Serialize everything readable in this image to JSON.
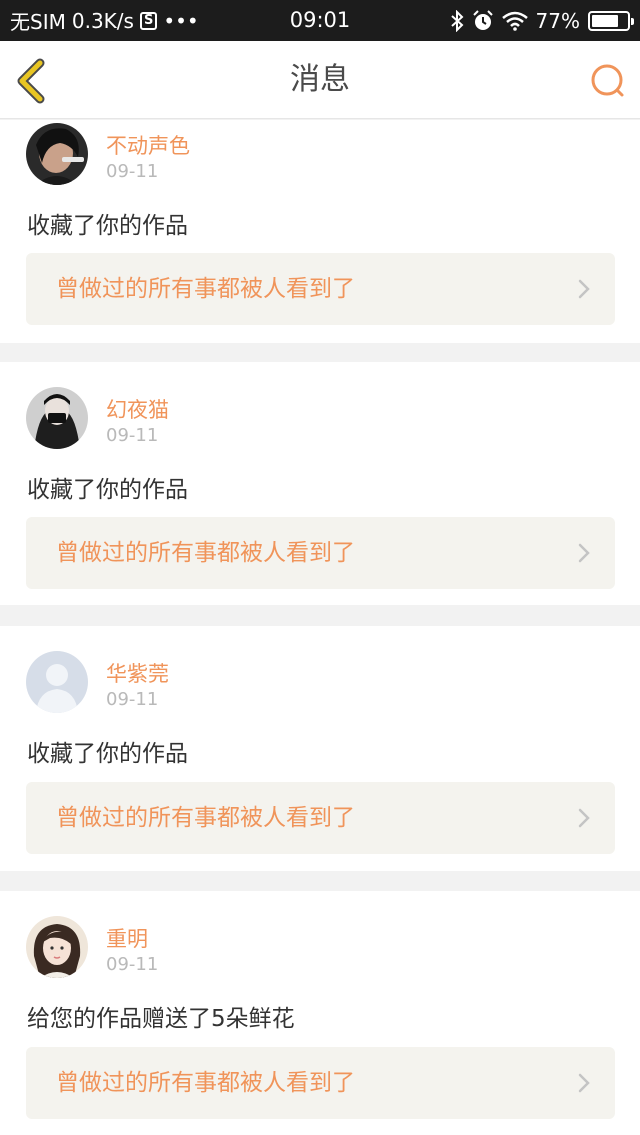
{
  "status_bar": {
    "carrier": "无SIM",
    "speed": "0.3K/s",
    "s_badge": "S",
    "dots": "•••",
    "time": "09:01",
    "battery": "77%",
    "battery_level": 0.77,
    "icons": [
      "bluetooth-icon",
      "alarm-icon",
      "wifi-icon",
      "battery-icon"
    ]
  },
  "header": {
    "title": "消息",
    "back_icon": "chevron-left-icon",
    "search_icon": "search-icon",
    "accent": "#f0945a",
    "back_color": "#e9c623"
  },
  "messages": [
    {
      "username": "不动声色",
      "time": "09-11",
      "action": "收藏了你的作品",
      "work_title": "曾做过的所有事都被人看到了",
      "avatar": "dark-portrait-avatar"
    },
    {
      "username": "幻夜猫",
      "time": "09-11",
      "action": "收藏了你的作品",
      "work_title": "曾做过的所有事都被人看到了",
      "avatar": "masked-figure-avatar"
    },
    {
      "username": "华紫莞",
      "time": "09-11",
      "action": "收藏了你的作品",
      "work_title": "曾做过的所有事都被人看到了",
      "avatar": "default-user-avatar"
    },
    {
      "username": "重明",
      "time": "09-11",
      "action": "给您的作品赠送了5朵鲜花",
      "work_title": "曾做过的所有事都被人看到了",
      "avatar": "illustrated-girl-avatar"
    }
  ]
}
